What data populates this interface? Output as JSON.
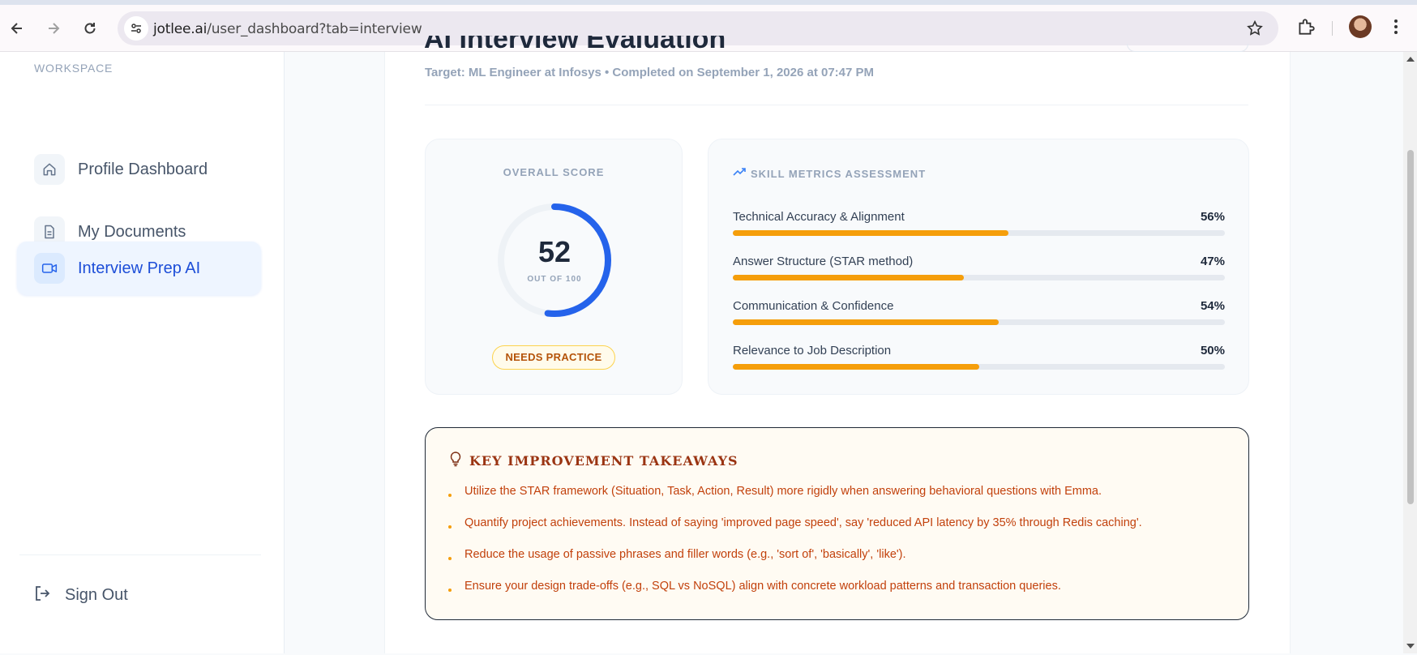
{
  "browser": {
    "url_domain": "jotlee.ai",
    "url_path": "/user_dashboard?tab=interview"
  },
  "sidebar": {
    "section_label": "WORKSPACE",
    "items": [
      {
        "label": "Profile Dashboard",
        "icon": "home-icon"
      },
      {
        "label": "My Documents",
        "icon": "document-icon"
      },
      {
        "label": "Interview Prep AI",
        "icon": "video-icon",
        "active": true
      }
    ],
    "sign_out": "Sign Out"
  },
  "page": {
    "title": "AI Interview Evaluation",
    "subtitle": "Target: ML Engineer at Infosys • Completed on September 1, 2026 at 07:47 PM"
  },
  "score": {
    "label": "OVERALL SCORE",
    "value": "52",
    "out_of": "OUT OF 100",
    "fraction": 0.52,
    "badge": "NEEDS PRACTICE"
  },
  "metrics": {
    "header": "SKILL METRICS ASSESSMENT",
    "items": [
      {
        "name": "Technical Accuracy & Alignment",
        "value": "56%",
        "fraction": 0.56
      },
      {
        "name": "Answer Structure (STAR method)",
        "value": "47%",
        "fraction": 0.47
      },
      {
        "name": "Communication & Confidence",
        "value": "54%",
        "fraction": 0.54
      },
      {
        "name": "Relevance to Job Description",
        "value": "50%",
        "fraction": 0.5
      }
    ]
  },
  "takeaways": {
    "title": "KEY IMPROVEMENT TAKEAWAYS",
    "items": [
      "Utilize the STAR framework (Situation, Task, Action, Result) more rigidly when answering behavioral questions with Emma.",
      "Quantify project achievements. Instead of saying 'improved page speed', say 'reduced API latency by 35% through Redis caching'.",
      "Reduce the usage of passive phrases and filler words (e.g., 'sort of', 'basically', 'like').",
      "Ensure your design trade-offs (e.g., SQL vs NoSQL) align with concrete workload patterns and transaction queries."
    ]
  },
  "colors": {
    "accent": "#2563eb",
    "bar": "#f59e0b",
    "takeaway_text": "#c2410c"
  }
}
